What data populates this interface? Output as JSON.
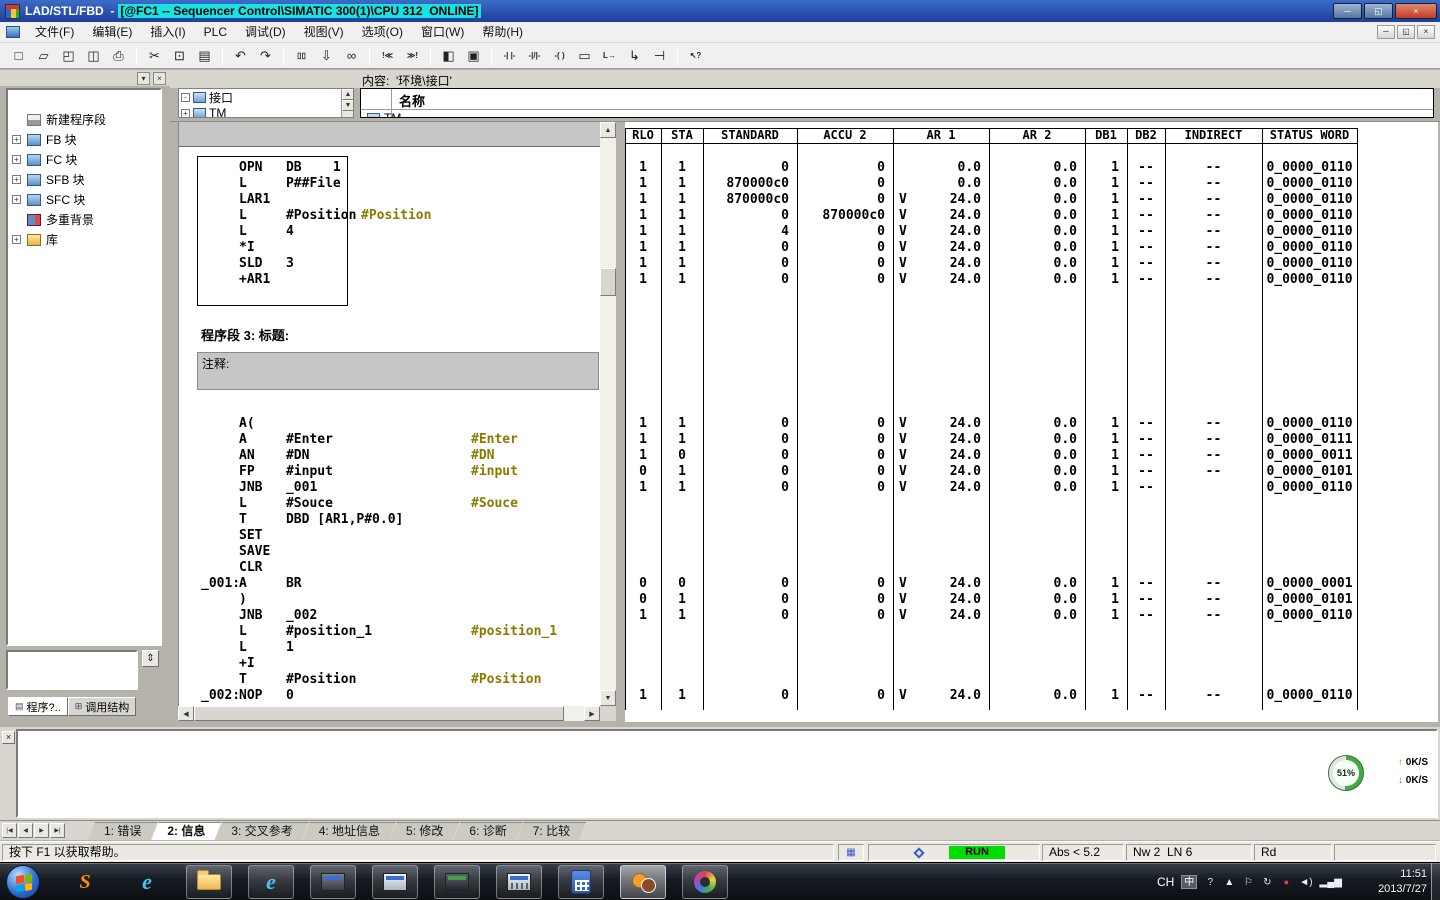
{
  "titlebar": {
    "title_prefix": "LAD/STL/FBD  -",
    "title_highlight": "[@FC1 -- Sequencer Control\\SIMATIC 300(1)\\CPU 312  ONLINE]",
    "buttons": [
      {
        "name": "minimize-button",
        "glyph": "─"
      },
      {
        "name": "maximize-button",
        "glyph": "◱"
      },
      {
        "name": "close-button",
        "glyph": "×"
      }
    ]
  },
  "menubar": {
    "items": [
      "文件(F)",
      "编辑(E)",
      "插入(I)",
      "PLC",
      "调试(D)",
      "视图(V)",
      "选项(O)",
      "窗口(W)",
      "帮助(H)"
    ],
    "mdi_buttons": [
      {
        "name": "mdi-minimize-button",
        "glyph": "─"
      },
      {
        "name": "mdi-restore-button",
        "glyph": "◱"
      },
      {
        "name": "mdi-close-button",
        "glyph": "×"
      }
    ]
  },
  "toolbar": {
    "buttons": [
      {
        "name": "new-icon",
        "glyph": "□"
      },
      {
        "name": "open-icon",
        "glyph": "▱"
      },
      {
        "name": "save-download-icon",
        "glyph": "◰"
      },
      {
        "name": "save-icon",
        "glyph": "◫"
      },
      {
        "name": "print-icon",
        "glyph": "⎙"
      },
      {
        "sep": true
      },
      {
        "name": "cut-icon",
        "glyph": "✂"
      },
      {
        "name": "copy-icon",
        "glyph": "⊡"
      },
      {
        "name": "paste-icon",
        "glyph": "▤"
      },
      {
        "sep": true
      },
      {
        "name": "undo-icon",
        "glyph": "↶"
      },
      {
        "name": "redo-icon",
        "glyph": "↷"
      },
      {
        "sep": true
      },
      {
        "name": "view-pair-icon",
        "glyph": "▯▯",
        "small": true
      },
      {
        "name": "download-icon",
        "glyph": "⇩"
      },
      {
        "name": "monitor-glasses-icon",
        "glyph": "∞"
      },
      {
        "sep": true
      },
      {
        "name": "prev-error-icon",
        "glyph": "!≪",
        "small": true
      },
      {
        "name": "next-error-icon",
        "glyph": "≫!",
        "small": true
      },
      {
        "sep": true
      },
      {
        "name": "split-view-icon",
        "glyph": "◧"
      },
      {
        "name": "detail-view-icon",
        "glyph": "▣"
      },
      {
        "sep": true
      },
      {
        "name": "contact-no-icon",
        "glyph": "-| |-",
        "small": true
      },
      {
        "name": "contact-nc-icon",
        "glyph": "-|/|-",
        "small": true
      },
      {
        "name": "coil-icon",
        "glyph": "-( )",
        "small": true
      },
      {
        "name": "empty-box-icon",
        "glyph": "▭"
      },
      {
        "name": "jump-icon",
        "glyph": "L→",
        "small": true
      },
      {
        "name": "open-branch-icon",
        "glyph": "↳"
      },
      {
        "name": "close-branch-icon",
        "glyph": "⊣"
      },
      {
        "sep": true
      },
      {
        "name": "help-cursor-icon",
        "glyph": "↖?",
        "small": true
      }
    ]
  },
  "panel_header": {
    "content_label": "内容:  '环境\\接口'",
    "tree_root": "接口",
    "tree_child": "TM",
    "name_header": "名称",
    "row_sliver": "TM",
    "root_expander": "-",
    "child_expander": "+"
  },
  "sidebar": {
    "drop_glyph": "▾",
    "close_glyph": "×",
    "updown_glyph": "⇕",
    "items": [
      {
        "name": "sidebar-item-new-network",
        "label": "新建程序段",
        "icon": "network-title-icon",
        "expand": false
      },
      {
        "name": "sidebar-item-fb-blocks",
        "label": "FB 块",
        "icon": "block-folder-icon",
        "expand": true
      },
      {
        "name": "sidebar-item-fc-blocks",
        "label": "FC 块",
        "icon": "block-folder-icon",
        "expand": true
      },
      {
        "name": "sidebar-item-sfb-blocks",
        "label": "SFB 块",
        "icon": "block-folder-icon",
        "expand": true
      },
      {
        "name": "sidebar-item-sfc-blocks",
        "label": "SFC 块",
        "icon": "block-folder-icon",
        "expand": true
      },
      {
        "name": "sidebar-item-multi-instance",
        "label": "多重背景",
        "icon": "multi-instance-icon",
        "expand": false
      },
      {
        "name": "sidebar-item-library",
        "label": "库",
        "icon": "library-icon",
        "expand": true
      }
    ],
    "tabs": [
      {
        "name": "tab-program-elements",
        "label": "程序?..",
        "icon": "▤",
        "active": true
      },
      {
        "name": "tab-call-structure",
        "label": "调用结构",
        "icon": "⊞",
        "active": false
      }
    ]
  },
  "editor": {
    "network_header": "程序段 3: 标题:",
    "comment_label": "注释:",
    "lines": [
      [
        0,
        "",
        "OPN   DB    1",
        "",
        0
      ],
      [
        1,
        "",
        "L     P##File",
        "",
        0
      ],
      [
        2,
        "",
        "LAR1",
        "",
        0
      ],
      [
        3,
        "",
        "L     #Position",
        "#Position",
        360
      ],
      [
        4,
        "",
        "L     4",
        "",
        0
      ],
      [
        5,
        "",
        "*I",
        "",
        0
      ],
      [
        6,
        "",
        "SLD   3",
        "",
        0
      ],
      [
        7,
        "",
        "+AR1",
        "",
        0
      ],
      [
        16,
        "",
        "A(",
        "",
        0
      ],
      [
        17,
        "",
        "A     #Enter",
        "#Enter",
        470
      ],
      [
        18,
        "",
        "AN    #DN",
        "#DN",
        470
      ],
      [
        19,
        "",
        "FP    #input",
        "#input",
        470
      ],
      [
        20,
        "",
        "JNB   _001",
        "",
        0
      ],
      [
        21,
        "",
        "L     #Souce",
        "#Souce",
        470
      ],
      [
        22,
        "",
        "T     DBD [AR1,P#0.0]",
        "",
        0
      ],
      [
        23,
        "",
        "SET",
        "",
        0
      ],
      [
        24,
        "",
        "SAVE",
        "",
        0
      ],
      [
        25,
        "",
        "CLR",
        "",
        0
      ],
      [
        26,
        "_001:",
        "A     BR",
        "",
        0
      ],
      [
        27,
        "",
        ")",
        "",
        0
      ],
      [
        28,
        "",
        "JNB   _002",
        "",
        0
      ],
      [
        29,
        "",
        "L     #position_1",
        "#position_1",
        470
      ],
      [
        30,
        "",
        "L     1",
        "",
        0
      ],
      [
        31,
        "",
        "+I",
        "",
        0
      ],
      [
        32,
        "",
        "T     #Position",
        "#Position",
        470
      ],
      [
        33,
        "_002:",
        "NOP   0",
        "",
        0
      ]
    ]
  },
  "table": {
    "headers": [
      "RLO",
      "STA",
      "STANDARD",
      "ACCU 2",
      "AR 1",
      "AR 2",
      "DB1",
      "DB2",
      "INDIRECT",
      "STATUS WORD"
    ],
    "rows": [
      [
        0,
        "1",
        "1",
        "0",
        "0",
        "",
        "0.0",
        "0.0",
        "1",
        "--",
        "--",
        "0_0000_0110"
      ],
      [
        1,
        "1",
        "1",
        "870000c0",
        "0",
        "",
        "0.0",
        "0.0",
        "1",
        "--",
        "--",
        "0_0000_0110"
      ],
      [
        2,
        "1",
        "1",
        "870000c0",
        "0",
        "V",
        "24.0",
        "0.0",
        "1",
        "--",
        "--",
        "0_0000_0110"
      ],
      [
        3,
        "1",
        "1",
        "0",
        "870000c0",
        "V",
        "24.0",
        "0.0",
        "1",
        "--",
        "--",
        "0_0000_0110"
      ],
      [
        4,
        "1",
        "1",
        "4",
        "0",
        "V",
        "24.0",
        "0.0",
        "1",
        "--",
        "--",
        "0_0000_0110"
      ],
      [
        5,
        "1",
        "1",
        "0",
        "0",
        "V",
        "24.0",
        "0.0",
        "1",
        "--",
        "--",
        "0_0000_0110"
      ],
      [
        6,
        "1",
        "1",
        "0",
        "0",
        "V",
        "24.0",
        "0.0",
        "1",
        "--",
        "--",
        "0_0000_0110"
      ],
      [
        7,
        "1",
        "1",
        "0",
        "0",
        "V",
        "24.0",
        "0.0",
        "1",
        "--",
        "--",
        "0_0000_0110"
      ],
      [
        16,
        "1",
        "1",
        "0",
        "0",
        "V",
        "24.0",
        "0.0",
        "1",
        "--",
        "--",
        "0_0000_0110"
      ],
      [
        17,
        "1",
        "1",
        "0",
        "0",
        "V",
        "24.0",
        "0.0",
        "1",
        "--",
        "--",
        "0_0000_0111"
      ],
      [
        18,
        "1",
        "0",
        "0",
        "0",
        "V",
        "24.0",
        "0.0",
        "1",
        "--",
        "--",
        "0_0000_0011"
      ],
      [
        19,
        "0",
        "1",
        "0",
        "0",
        "V",
        "24.0",
        "0.0",
        "1",
        "--",
        "--",
        "0_0000_0101"
      ],
      [
        20,
        "1",
        "1",
        "0",
        "0",
        "V",
        "24.0",
        "0.0",
        "1",
        "--",
        "",
        "0_0000_0110"
      ],
      [
        26,
        "0",
        "0",
        "0",
        "0",
        "V",
        "24.0",
        "0.0",
        "1",
        "--",
        "--",
        "0_0000_0001"
      ],
      [
        27,
        "0",
        "1",
        "0",
        "0",
        "V",
        "24.0",
        "0.0",
        "1",
        "--",
        "--",
        "0_0000_0101"
      ],
      [
        28,
        "1",
        "1",
        "0",
        "0",
        "V",
        "24.0",
        "0.0",
        "1",
        "--",
        "--",
        "0_0000_0110"
      ],
      [
        33,
        "1",
        "1",
        "0",
        "0",
        "V",
        "24.0",
        "0.0",
        "1",
        "--",
        "--",
        "0_0000_0110"
      ]
    ]
  },
  "scroll": {
    "up": "▲",
    "down": "▼",
    "left": "◀",
    "right": "▶"
  },
  "message_pane": {
    "close_glyph": "×",
    "gauge_percent": "51%",
    "up_arrow": "↑",
    "down_arrow": "↓",
    "upload_rate": "0K/S",
    "download_rate": "0K/S"
  },
  "bottom_tabs": {
    "vcr": [
      {
        "name": "first-tab-button",
        "glyph": "|◀"
      },
      {
        "name": "prev-tab-button",
        "glyph": "◀"
      },
      {
        "name": "next-tab-button",
        "glyph": "▶"
      },
      {
        "name": "last-tab-button",
        "glyph": "▶|"
      }
    ],
    "items": [
      "1: 错误",
      "2: 信息",
      "3: 交叉参考",
      "4: 地址信息",
      "5: 修改",
      "6: 诊断",
      "7: 比较"
    ],
    "active_index": 1
  },
  "statusbar": {
    "help_text": "按下 F1 以获取帮助。",
    "mod_icon_glyph": "▦",
    "run_label": "RUN",
    "abs_label": "Abs < 5.2",
    "network_label": "Nw 2  LN 6",
    "rd_label": "Rd"
  },
  "taskbar": {
    "apps": [
      {
        "name": "sogou-browser-icon",
        "style": "sogou",
        "glyph": "S",
        "framed": false,
        "active": false
      },
      {
        "name": "internet-explorer-icon",
        "style": "ie",
        "glyph": "e",
        "framed": false,
        "active": false
      },
      {
        "name": "file-explorer-icon",
        "style": "folder",
        "glyph": "",
        "framed": true,
        "active": false
      },
      {
        "name": "internet-explorer-2-icon",
        "style": "ie",
        "glyph": "e",
        "framed": true,
        "active": false
      },
      {
        "name": "simatic-manager-icon",
        "style": "appdark",
        "glyph": "",
        "framed": true,
        "active": false
      },
      {
        "name": "hw-config-icon",
        "style": "appgray",
        "glyph": "",
        "framed": true,
        "active": false
      },
      {
        "name": "plcsim-icon",
        "style": "appdark2",
        "glyph": "",
        "framed": true,
        "active": false
      },
      {
        "name": "var-table-icon",
        "style": "appgrid",
        "glyph": "",
        "framed": true,
        "active": false
      },
      {
        "name": "calculator-icon",
        "style": "calc",
        "glyph": "",
        "framed": true,
        "active": false
      },
      {
        "name": "user-accounts-icon",
        "style": "people",
        "glyph": "",
        "framed": true,
        "active": true
      },
      {
        "name": "paint-icon",
        "style": "palette",
        "glyph": "",
        "framed": true,
        "active": false
      }
    ],
    "lang_label": "CH",
    "tray_icons": [
      {
        "name": "ime-icon",
        "glyph": "中",
        "style": "ime"
      },
      {
        "name": "help-icon",
        "glyph": "?",
        "style": ""
      },
      {
        "name": "hidden-icons-arrow",
        "glyph": "▲",
        "style": ""
      },
      {
        "name": "action-center-flag-icon",
        "glyph": "⚐",
        "style": ""
      },
      {
        "name": "sync-icon",
        "glyph": "↻",
        "style": ""
      },
      {
        "name": "alert-badge-icon",
        "glyph": "●",
        "style": "red"
      },
      {
        "name": "volume-icon",
        "glyph": "◄)",
        "style": ""
      },
      {
        "name": "network-icon",
        "glyph": "▂▄▆",
        "style": ""
      }
    ],
    "clock_time": "11:51",
    "clock_date": "2013/7/27"
  },
  "colors": {
    "run_green": "#00dd00",
    "comment_olive": "#8a7a00",
    "title_highlight_cyan": "#17e3e3"
  }
}
